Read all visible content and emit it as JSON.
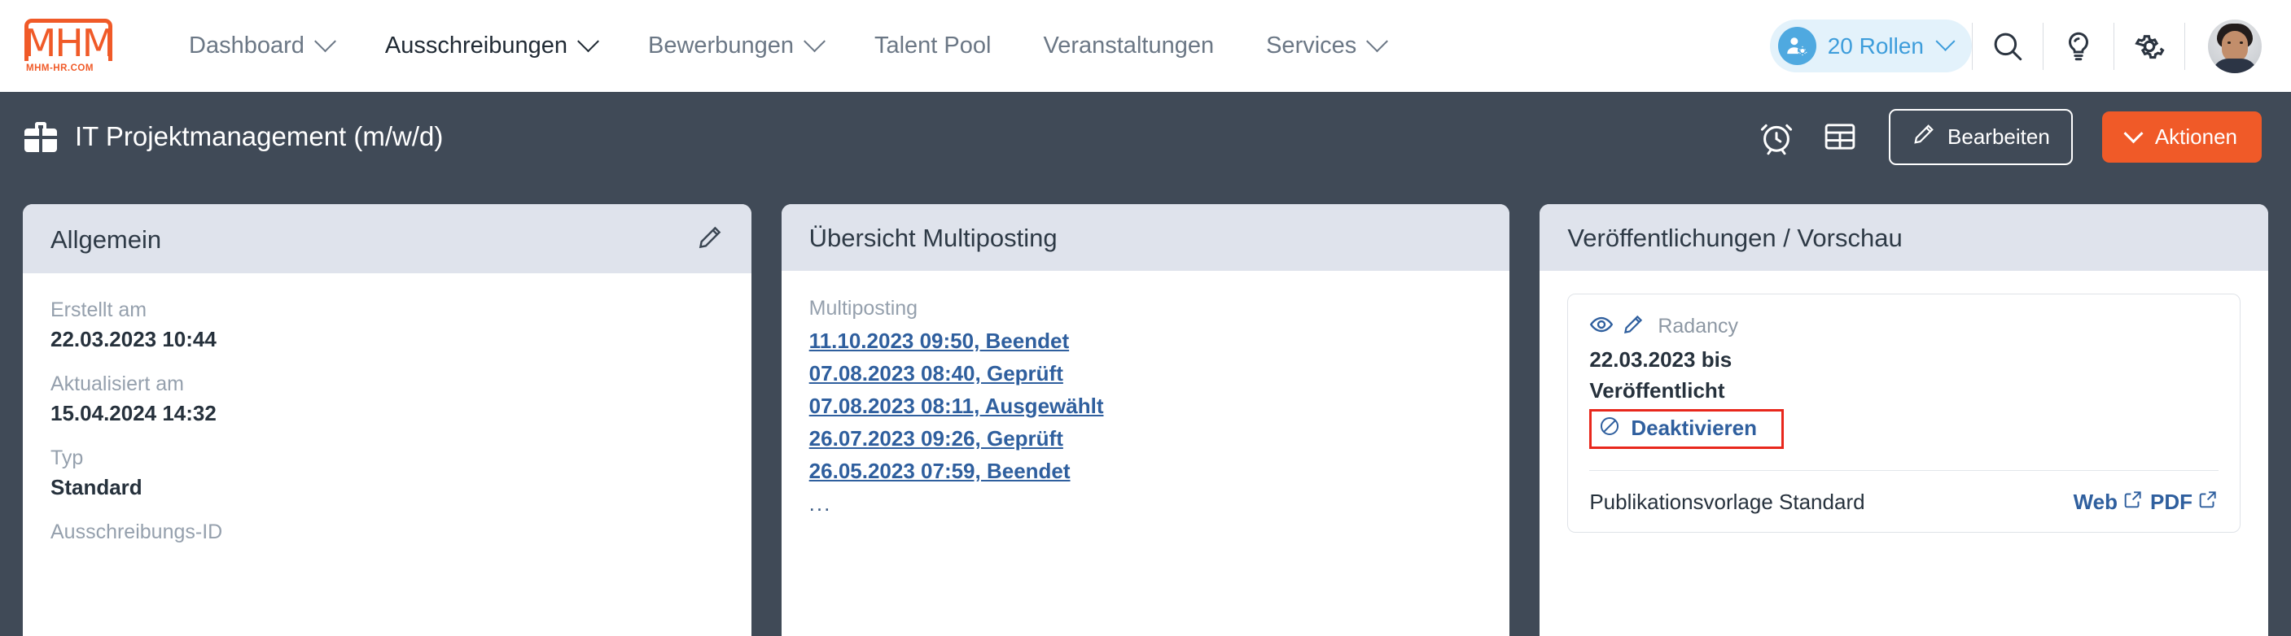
{
  "brand": {
    "logo_letters": "MHM",
    "logo_subtitle": "MHM-HR.COM",
    "accent_orange": "#f05a28",
    "nav_blue": "#3d9ddb",
    "link_blue": "#2f5f9e",
    "dark_bar": "#404a57",
    "highlight_red": "#e8271c"
  },
  "topnav": {
    "items": [
      {
        "label": "Dashboard",
        "has_chevron": true,
        "active": false
      },
      {
        "label": "Ausschreibungen",
        "has_chevron": true,
        "active": true
      },
      {
        "label": "Bewerbungen",
        "has_chevron": true,
        "active": false
      },
      {
        "label": "Talent Pool",
        "has_chevron": false,
        "active": false
      },
      {
        "label": "Veranstaltungen",
        "has_chevron": false,
        "active": false
      },
      {
        "label": "Services",
        "has_chevron": true,
        "active": false
      }
    ],
    "roles_pill": {
      "label": "20 Rollen",
      "icon": "user-gear-icon",
      "chevron": "chevron-down-icon"
    },
    "icons": [
      {
        "name": "search-icon"
      },
      {
        "name": "lightbulb-icon"
      },
      {
        "name": "gear-icon"
      }
    ],
    "avatar": "user-avatar"
  },
  "titlebar": {
    "icon": "briefcase-icon",
    "title": "IT Projektmanagement (m/w/d)",
    "icons": [
      {
        "name": "alarm-clock-icon"
      },
      {
        "name": "table-grid-icon"
      }
    ],
    "edit_button": {
      "label": "Bearbeiten",
      "icon": "pencil-icon"
    },
    "actions_button": {
      "label": "Aktionen",
      "icon": "chevron-down-icon"
    }
  },
  "cards": [
    {
      "title": "Allgemein",
      "head_icon": "pencil-icon",
      "fields": [
        {
          "label": "Erstellt am",
          "value": "22.03.2023 10:44"
        },
        {
          "label": "Aktualisiert am",
          "value": "15.04.2024 14:32"
        },
        {
          "label": "Typ",
          "value": "Standard"
        },
        {
          "label": "Ausschreibungs-ID",
          "value": ""
        }
      ]
    },
    {
      "title": "Übersicht Multiposting",
      "list_label": "Multiposting",
      "links": [
        "11.10.2023 09:50, Beendet",
        "07.08.2023 08:40, Geprüft",
        "07.08.2023 08:11, Ausgewählt",
        "26.07.2023 09:26, Geprüft",
        "26.05.2023 07:59, Beendet"
      ],
      "more": "..."
    },
    {
      "title": "Veröffentlichungen / Vorschau",
      "publication": {
        "preview_icon": "eye-icon",
        "edit_icon": "pencil-icon",
        "vendor": "Radancy",
        "date": "22.03.2023 bis",
        "state": "Veröffentlicht",
        "deactivate": {
          "label": "Deaktivieren",
          "icon": "ban-icon"
        },
        "template_label": "Publikationsvorlage Standard",
        "links": [
          {
            "label": "Web",
            "icon": "external-link-icon"
          },
          {
            "label": "PDF",
            "icon": "external-link-icon"
          }
        ]
      }
    }
  ]
}
